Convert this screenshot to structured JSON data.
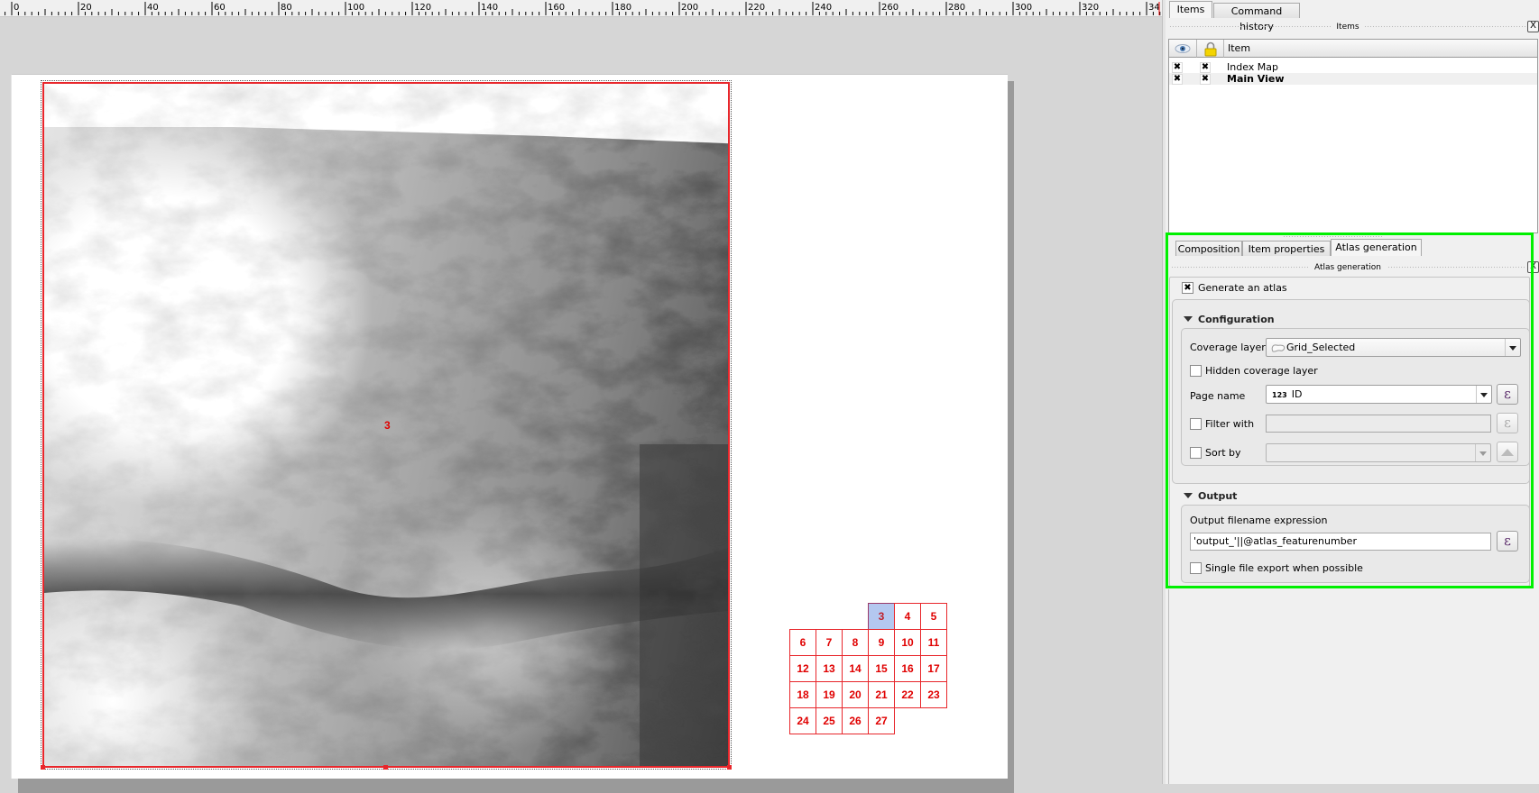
{
  "ruler": {
    "labels": [
      "0",
      "20",
      "40",
      "60",
      "80",
      "100",
      "120",
      "140",
      "160",
      "180",
      "200",
      "220",
      "240",
      "260",
      "280",
      "300",
      "320",
      "34"
    ]
  },
  "composition": {
    "main_map_label": "3",
    "index_map": {
      "cells": [
        {
          "id": "3",
          "selected": true
        },
        {
          "id": "4"
        },
        {
          "id": "5"
        },
        {
          "id": "6"
        },
        {
          "id": "7"
        },
        {
          "id": "8"
        },
        {
          "id": "9"
        },
        {
          "id": "10"
        },
        {
          "id": "11"
        },
        {
          "id": "12"
        },
        {
          "id": "13"
        },
        {
          "id": "14"
        },
        {
          "id": "15"
        },
        {
          "id": "16"
        },
        {
          "id": "17"
        },
        {
          "id": "18"
        },
        {
          "id": "19"
        },
        {
          "id": "20"
        },
        {
          "id": "21"
        },
        {
          "id": "22"
        },
        {
          "id": "23"
        },
        {
          "id": "24"
        },
        {
          "id": "25"
        },
        {
          "id": "26"
        },
        {
          "id": "27"
        }
      ],
      "selected_color": "#b4c8f0",
      "line_color": "#e8262b"
    }
  },
  "panel": {
    "top_tabs": [
      {
        "label": "Items",
        "active": true
      },
      {
        "label": "Command history",
        "active": false
      }
    ],
    "items_dock_title": "Items",
    "items_tree": {
      "columns": [
        "",
        "",
        "Item"
      ],
      "column_icons": [
        "eye-icon",
        "lock-icon"
      ],
      "rows": [
        {
          "visible": true,
          "locked": true,
          "name": "Index Map",
          "selected": false
        },
        {
          "visible": true,
          "locked": true,
          "name": "Main View",
          "selected": true
        }
      ]
    },
    "bottom_tabs": [
      {
        "label": "Composition",
        "active": false
      },
      {
        "label": "Item properties",
        "active": false
      },
      {
        "label": "Atlas generation",
        "active": true
      }
    ],
    "atlas_dock_title": "Atlas generation",
    "atlas": {
      "generate_label": "Generate an atlas",
      "generate_checked": true,
      "configuration": {
        "title": "Configuration",
        "coverage_layer_label": "Coverage layer",
        "coverage_layer_value": "Grid_Selected",
        "hidden_coverage_label": "Hidden coverage layer",
        "hidden_coverage_checked": false,
        "page_name_label": "Page name",
        "page_name_type": "123",
        "page_name_value": "ID",
        "filter_label": "Filter with",
        "filter_checked": false,
        "filter_value": "",
        "sort_label": "Sort by",
        "sort_checked": false,
        "sort_value": ""
      },
      "output": {
        "title": "Output",
        "filename_label": "Output filename expression",
        "filename_value": "'output_'||@atlas_featurenumber",
        "single_file_label": "Single file export when possible",
        "single_file_checked": false
      },
      "epsilon_glyph": "ε",
      "highlight_color": "#00f000"
    },
    "close_glyph": "X",
    "check_glyph": "✖"
  }
}
